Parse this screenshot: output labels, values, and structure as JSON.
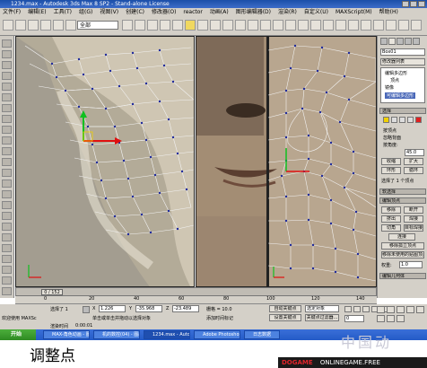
{
  "window": {
    "title": "1234.max - Autodesk 3ds Max 8 SP2 - Stand-alone License"
  },
  "menu": [
    "文件(F)",
    "编辑(E)",
    "工具(T)",
    "组(G)",
    "视图(V)",
    "创建(C)",
    "修改器(O)",
    "reactor",
    "动画(A)",
    "图形编辑器(D)",
    "渲染(R)",
    "自定义(U)",
    "MAXScript(M)",
    "帮助(H)"
  ],
  "toolbar": {
    "selection_filter": "全部"
  },
  "viewports": {
    "left": {
      "name": "left-viewport"
    },
    "right": {
      "name": "right-viewport"
    }
  },
  "command_panel": {
    "object_name": "Box01",
    "modifier_list": "修改器列表",
    "stack_items": [
      "编辑多边形",
      "顶点",
      "镜像",
      "可编辑多边形"
    ],
    "selection_header": "选择",
    "selection_options": [
      "按顶点",
      "忽略背面",
      "按角度:"
    ],
    "angle_value": "45.0",
    "shrink": "收缩",
    "grow": "扩大",
    "ring": "环形",
    "loop": "循环",
    "selected_count": "选择了 1 个顶点",
    "soft_selection": "软选择",
    "edit_vertices": "编辑顶点",
    "remove": "移除",
    "break": "断开",
    "extrude": "挤出",
    "weld": "焊接",
    "chamfer": "切角",
    "target_weld": "目标焊接",
    "connect": "连接",
    "remove_isolated": "移除孤立顶点",
    "remove_unused": "移除未使用的贴图顶点",
    "weight_label": "权重:",
    "weight_value": "1.0",
    "edit_geometry": "编辑几何体"
  },
  "timeline": {
    "frame_display": "0 / 152",
    "ruler_ticks": [
      "0",
      "20",
      "40",
      "60",
      "80",
      "100",
      "120",
      "140"
    ]
  },
  "status": {
    "selection_label": "选择了 1",
    "x": "1.226",
    "y": "-35.968",
    "z": "-23.489",
    "grid": "栅格 = 10.0",
    "auto_key": "自动关键点",
    "set_key": "设置关键点",
    "key_filter": "选定对象",
    "key_filter_btn": "关键点过滤器...",
    "prompt": "单击或单击并拖动以选择对象",
    "add_time_tag": "添加时间标记",
    "time_readout": "0:00:01",
    "script_label": "欢迎使用 MAXSc",
    "render_time": "渲染时间",
    "frame": "0"
  },
  "taskbar": {
    "start": "开始",
    "items": [
      "MAX-角色动画 - 图画",
      "机的数控(04) - 图画",
      "1234.max - Autod...",
      "Adobe Photoshop",
      "日志数据"
    ],
    "active_index": 2
  },
  "caption": "调整点",
  "branding": {
    "left": "DOGAME",
    "right": "ONLINEGAME.FREE",
    "watermark": "中国动"
  },
  "colors": {
    "title_bar": "#1b4fa8",
    "panel_bg": "#d4d0c8",
    "mesh_line": "#f2f2f2",
    "vertex": "#1f2a9c",
    "gizmo_x": "#e01010",
    "gizmo_y": "#10c020",
    "taskbar": "#245bc7"
  }
}
